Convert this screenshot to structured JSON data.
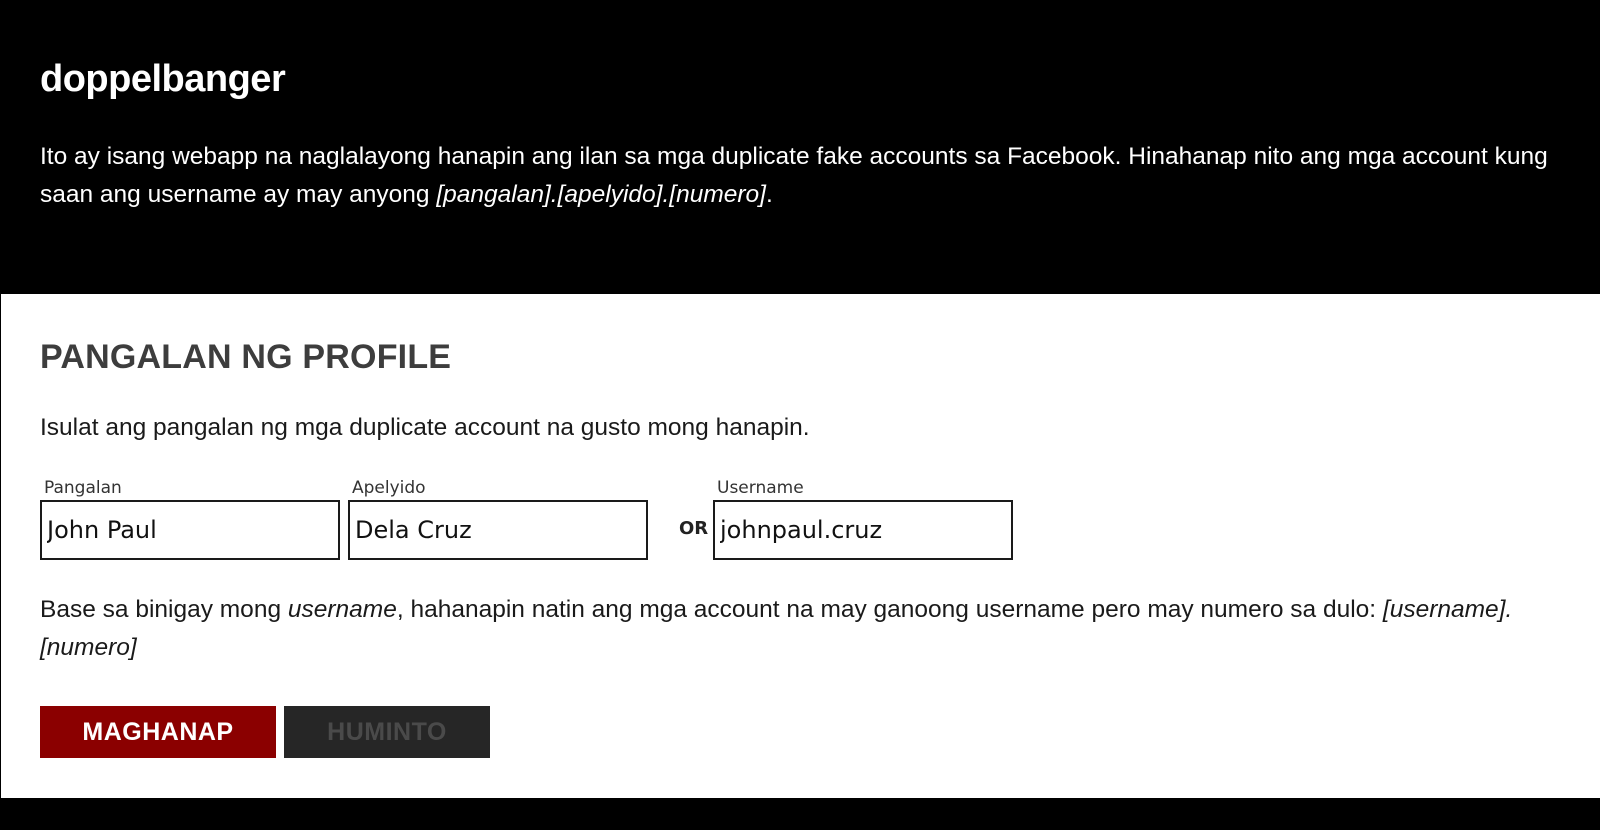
{
  "header": {
    "title": "doppelbanger",
    "intro_part1": "Ito ay isang webapp na naglalayong hanapin ang ilan sa mga duplicate fake accounts sa Facebook. Hinahanap nito ang mga account kung saan ang username ay may anyong ",
    "intro_pattern": "[pangalan].[apelyido].[numero]",
    "intro_end": "."
  },
  "profile": {
    "section_title": "PANGALAN NG PROFILE",
    "instructions": "Isulat ang pangalan ng mga duplicate account na gusto mong hanapin.",
    "first_name": {
      "label": "Pangalan",
      "value": "John Paul"
    },
    "last_name": {
      "label": "Apelyido",
      "value": "Dela Cruz"
    },
    "or_label": "OR",
    "username": {
      "label": "Username",
      "value": "johnpaul.cruz"
    },
    "desc_part1": "Base sa binigay mong ",
    "desc_em": "username",
    "desc_part2": ", hahanapin natin ang mga account na may ganoong username pero may numero sa dulo: ",
    "desc_pattern": "[username].[numero]"
  },
  "actions": {
    "search_label": "MAGHANAP",
    "stop_label": "HUMINTO"
  },
  "colors": {
    "background": "#000000",
    "panel": "#ffffff",
    "search_button": "#8b0000",
    "stop_button": "#262626"
  }
}
